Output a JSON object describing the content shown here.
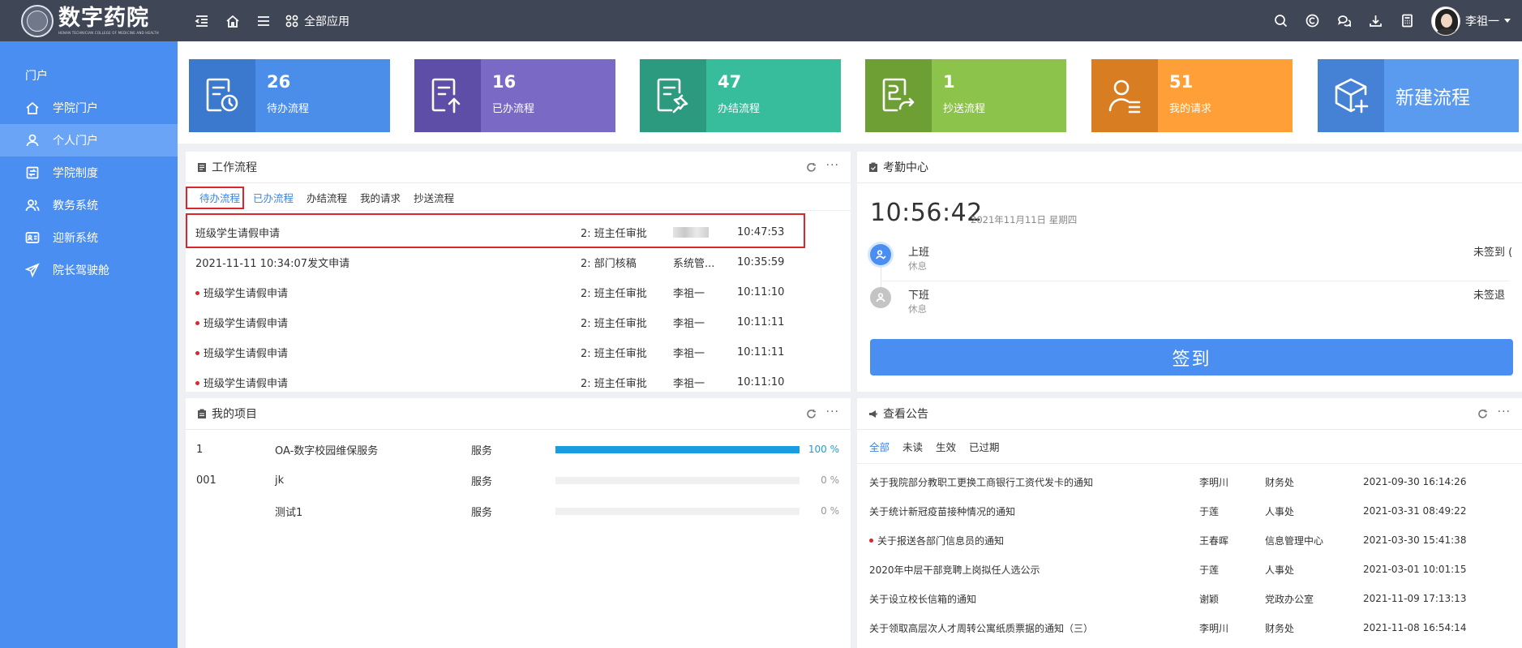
{
  "header": {
    "logo_name": "数字药院",
    "logo_subtitle": "HENAN TECHNICIAN COLLEGE OF MEDICINE AND HEALTH",
    "all_apps_label": "全部应用",
    "user_name": "李祖一"
  },
  "sidebar": {
    "heading": "门户",
    "items": [
      {
        "label": "学院门户",
        "icon": "home-icon"
      },
      {
        "label": "个人门户",
        "icon": "user-icon"
      },
      {
        "label": "学院制度",
        "icon": "document-icon"
      },
      {
        "label": "教务系统",
        "icon": "users-icon"
      },
      {
        "label": "迎新系统",
        "icon": "id-card-icon"
      },
      {
        "label": "院长驾驶舱",
        "icon": "send-icon"
      }
    ]
  },
  "cards": [
    {
      "count": "26",
      "label": "待办流程",
      "color": "#4a8ee9",
      "icon_bg": "#3b79cf"
    },
    {
      "count": "16",
      "label": "已办流程",
      "color": "#7a6ac5",
      "icon_bg": "#5f4ea8"
    },
    {
      "count": "47",
      "label": "办结流程",
      "color": "#38bd9c",
      "icon_bg": "#2b9a7e"
    },
    {
      "count": "1",
      "label": "抄送流程",
      "color": "#8cc34a",
      "icon_bg": "#6d9f34"
    },
    {
      "count": "51",
      "label": "我的请求",
      "color": "#ff9f38",
      "icon_bg": "#d97d22"
    },
    {
      "label": "新建流程",
      "color": "#5b9bef",
      "icon_bg": "#4582d6"
    }
  ],
  "workflow": {
    "title": "工作流程",
    "tabs": [
      "待办流程",
      "已办流程",
      "办结流程",
      "我的请求",
      "抄送流程"
    ],
    "rows": [
      {
        "title": "班级学生请假申请",
        "step": "2: 班主任审批",
        "user": "",
        "time": "10:47:53",
        "dot": false
      },
      {
        "title": "2021-11-11 10:34:07发文申请",
        "step": "2: 部门核稿",
        "user": "系统管...",
        "time": "10:35:59",
        "dot": false
      },
      {
        "title": "班级学生请假申请",
        "step": "2: 班主任审批",
        "user": "李祖一",
        "time": "10:11:10",
        "dot": true
      },
      {
        "title": "班级学生请假申请",
        "step": "2: 班主任审批",
        "user": "李祖一",
        "time": "10:11:11",
        "dot": true
      },
      {
        "title": "班级学生请假申请",
        "step": "2: 班主任审批",
        "user": "李祖一",
        "time": "10:11:11",
        "dot": true
      },
      {
        "title": "班级学生请假申请",
        "step": "2: 班主任审批",
        "user": "李祖一",
        "time": "10:11:10",
        "dot": true
      }
    ]
  },
  "attendance": {
    "title": "考勤中心",
    "time": "10:56:42",
    "date": "2021年11月11日   星期四",
    "rows": [
      {
        "name": "上班",
        "sub": "休息",
        "status": "未签到 ("
      },
      {
        "name": "下班",
        "sub": "休息",
        "status": "未签退"
      }
    ],
    "sign_label": "签到"
  },
  "projects": {
    "title": "我的项目",
    "rows": [
      {
        "id": "1",
        "name": "OA-数字校园维保服务",
        "type": "服务",
        "progress": 100,
        "pct": "100 %"
      },
      {
        "id": "001",
        "name": "jk",
        "type": "服务",
        "progress": 0,
        "pct": "0 %"
      },
      {
        "id": "",
        "name": "测试1",
        "type": "服务",
        "progress": 0,
        "pct": "0 %"
      }
    ]
  },
  "announcements": {
    "title": "查看公告",
    "tabs": [
      "全部",
      "未读",
      "生效",
      "已过期"
    ],
    "rows": [
      {
        "title": "关于我院部分教职工更换工商银行工资代发卡的通知",
        "author": "李明川",
        "dept": "财务处",
        "time": "2021-09-30 16:14:26",
        "dot": false
      },
      {
        "title": "关于统计新冠疫苗接种情况的通知",
        "author": "于莲",
        "dept": "人事处",
        "time": "2021-03-31 08:49:22",
        "dot": false
      },
      {
        "title": "关于报送各部门信息员的通知",
        "author": "王春晖",
        "dept": "信息管理中心",
        "time": "2021-03-30 15:41:38",
        "dot": true
      },
      {
        "title": "2020年中层干部竞聘上岗拟任人选公示",
        "author": "于莲",
        "dept": "人事处",
        "time": "2021-03-01 10:01:15",
        "dot": false
      },
      {
        "title": "关于设立校长信箱的通知",
        "author": "谢颖",
        "dept": "党政办公室",
        "time": "2021-11-09 17:13:13",
        "dot": false
      },
      {
        "title": "关于领取高层次人才周转公寓纸质票据的通知（三）",
        "author": "李明川",
        "dept": "财务处",
        "time": "2021-11-08 16:54:14",
        "dot": false
      }
    ]
  }
}
